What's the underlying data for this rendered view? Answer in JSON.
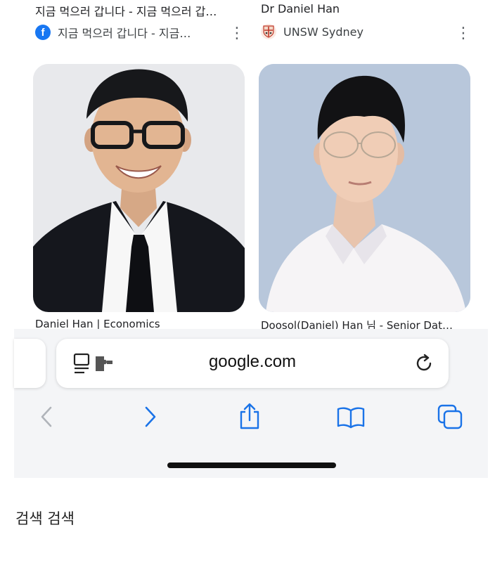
{
  "results": [
    {
      "title": "지금 먹으러 갑니다 - 지금 먹으러 갑…",
      "source": "지금 먹으러 갑니다 - 지금…",
      "source_icon": "facebook-icon",
      "caption": "Daniel Han | Economics"
    },
    {
      "title": "Dr Daniel Han",
      "source": "UNSW Sydney",
      "source_icon": "unsw-crest-icon",
      "caption": "Doosol(Daniel) Han 님 - Senior Dat…"
    }
  ],
  "address_bar": {
    "url": "google.com",
    "left_icon": "reader-extension-icon",
    "right_icon": "reload-icon"
  },
  "toolbar": {
    "buttons": [
      "back-icon",
      "forward-icon",
      "share-icon",
      "bookmarks-icon",
      "tabs-icon"
    ],
    "accent_color": "#1a73e8",
    "disabled_color": "#b0b4ba"
  },
  "footer": {
    "text": "검색 검색"
  }
}
